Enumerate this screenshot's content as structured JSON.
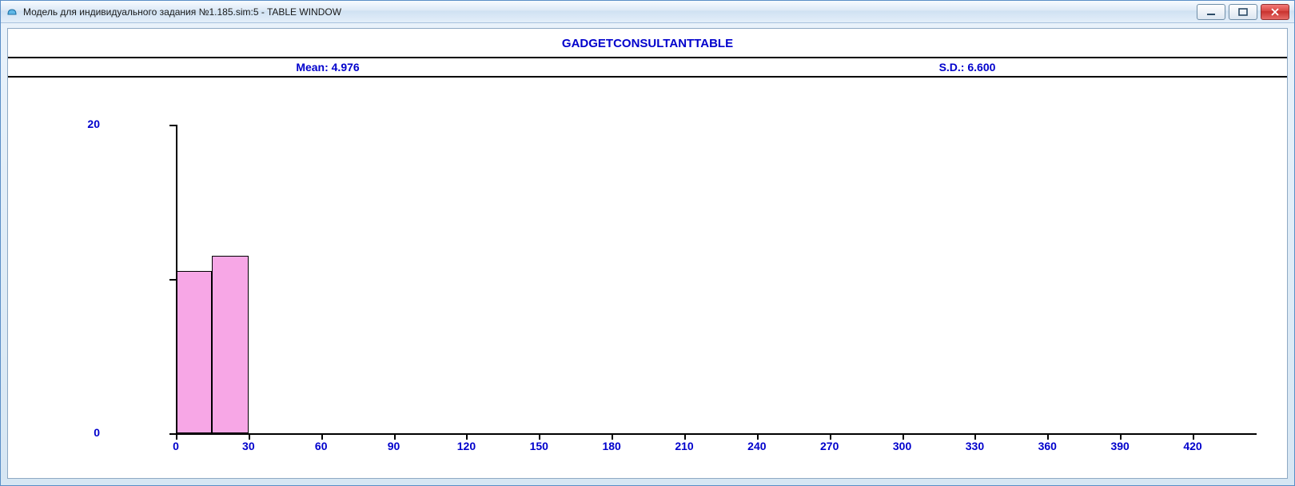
{
  "window": {
    "title": "Модель для индивидуального задания №1.185.sim:5  -  TABLE WINDOW"
  },
  "header": {
    "title": "GADGETCONSULTANTTABLE",
    "mean_label": "Mean: 4.976",
    "sd_label": "S.D.: 6.600"
  },
  "chart_data": {
    "type": "bar",
    "title": "GADGETCONSULTANTTABLE",
    "mean": 4.976,
    "sd": 6.6,
    "xlabel": "",
    "ylabel": "",
    "ylim": [
      0,
      20
    ],
    "y_ticks": [
      0,
      20
    ],
    "x_ticks": [
      0,
      30,
      60,
      90,
      120,
      150,
      180,
      210,
      240,
      270,
      300,
      330,
      360,
      390,
      420
    ],
    "bin_width": 15,
    "bars": [
      {
        "x_start": 0,
        "x_end": 15,
        "value": 10.5
      },
      {
        "x_start": 15,
        "x_end": 30,
        "value": 11.5
      }
    ]
  }
}
